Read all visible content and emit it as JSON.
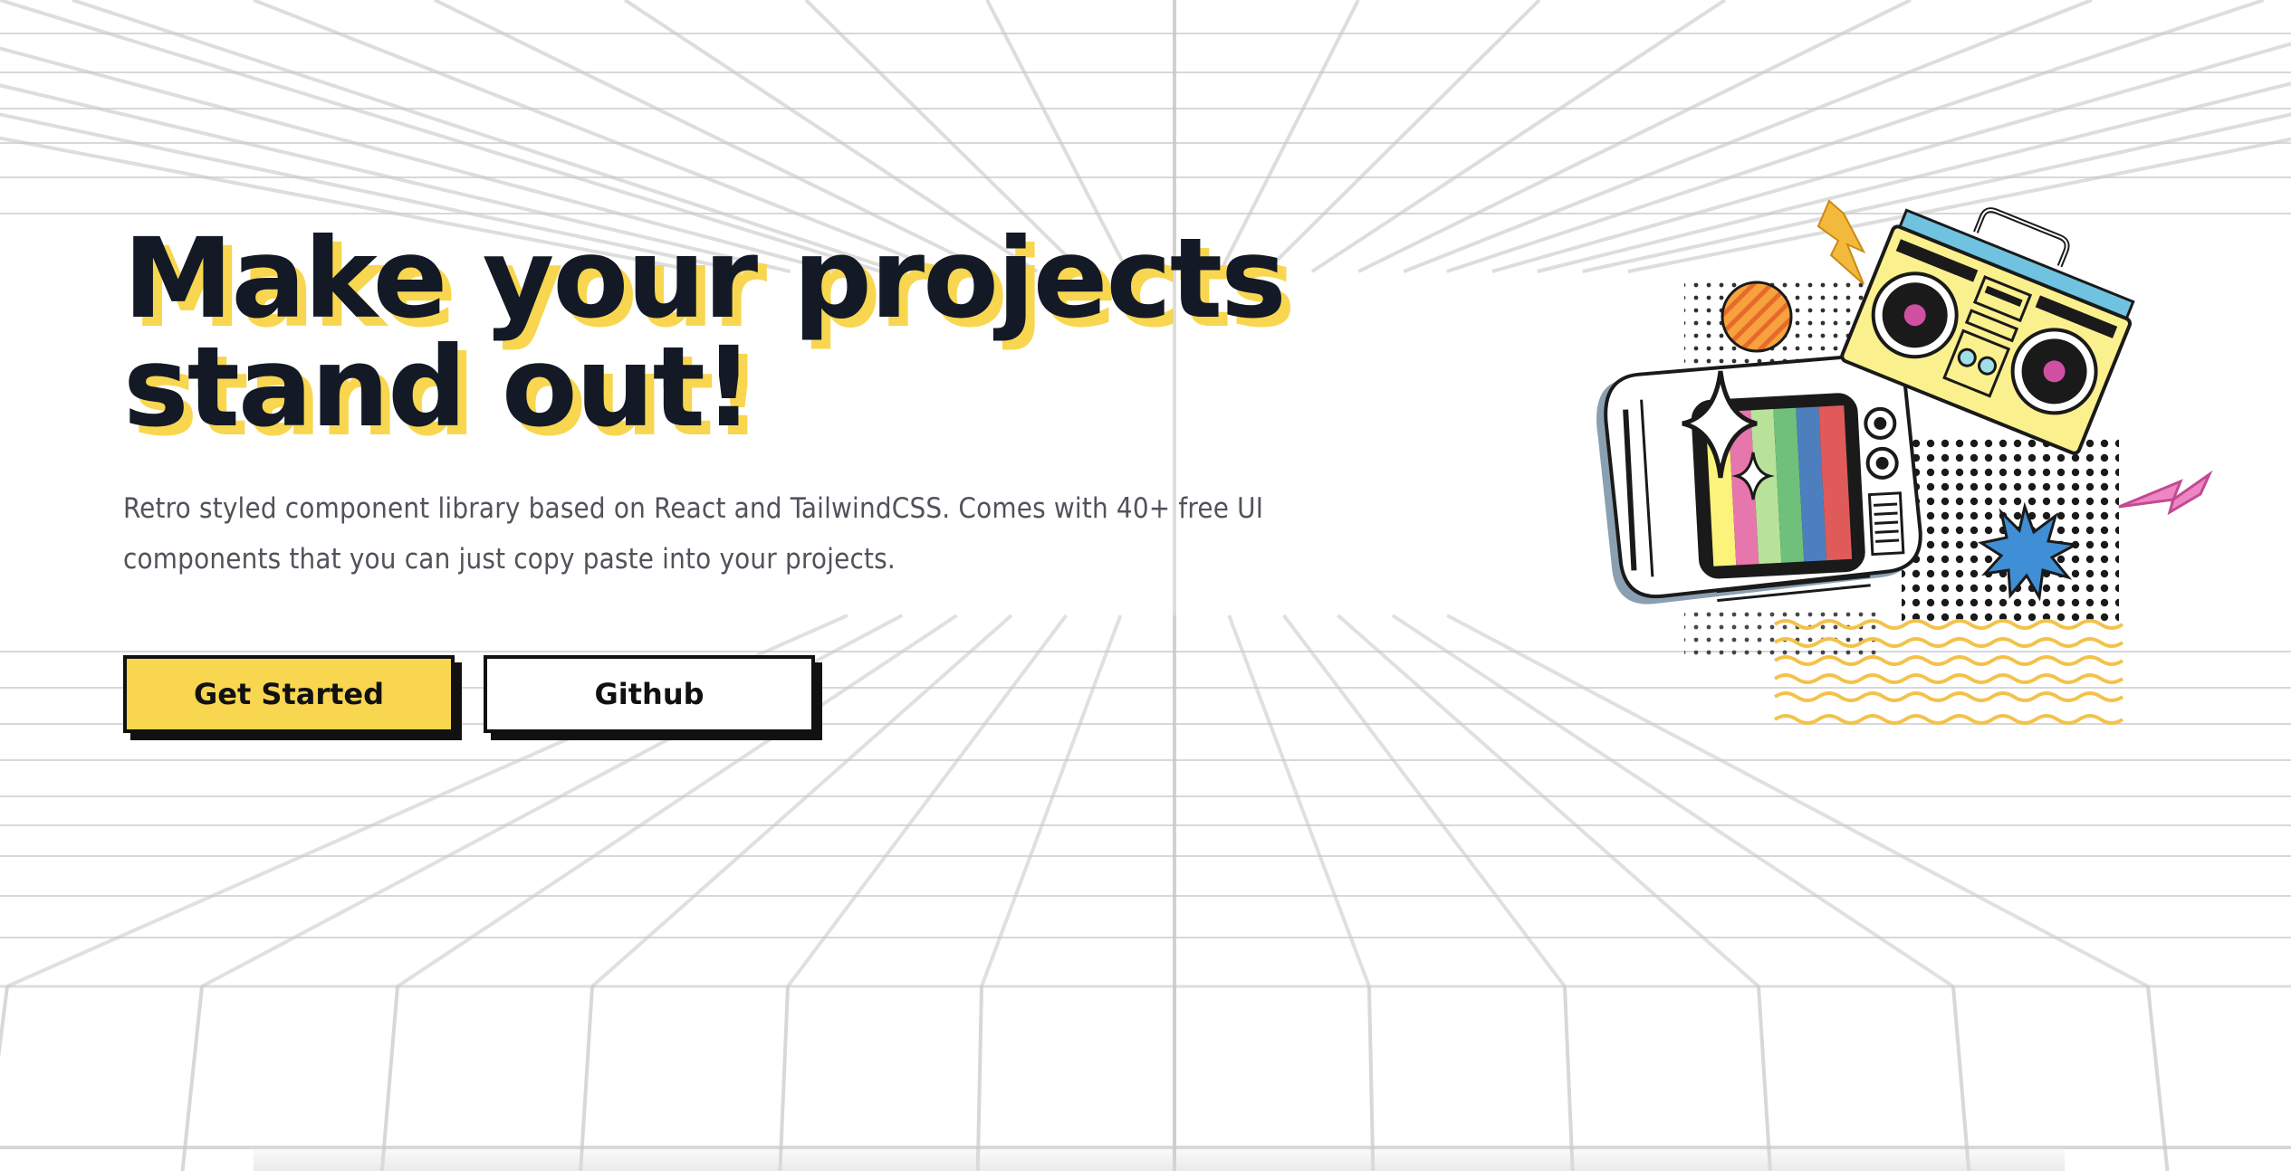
{
  "hero": {
    "headline_line1": "Make your projects",
    "headline_line2": "stand out!",
    "description": "Retro styled component library based on React and TailwindCSS. Comes with 40+ free UI components that you can just copy paste into your projects.",
    "primary_button": "Get Started",
    "secondary_button": "Github"
  },
  "colors": {
    "text_dark": "#131a26",
    "accent_yellow": "#f8d64f",
    "body_text": "#52525b",
    "grid_line": "#c8c8c8"
  },
  "illustration": {
    "icons": [
      "retro-tv-icon",
      "boombox-icon",
      "lightning-bolt-icon",
      "sparkle-star-icon",
      "burst-star-icon",
      "striped-circle-icon",
      "halftone-dots",
      "wavy-lines"
    ]
  }
}
